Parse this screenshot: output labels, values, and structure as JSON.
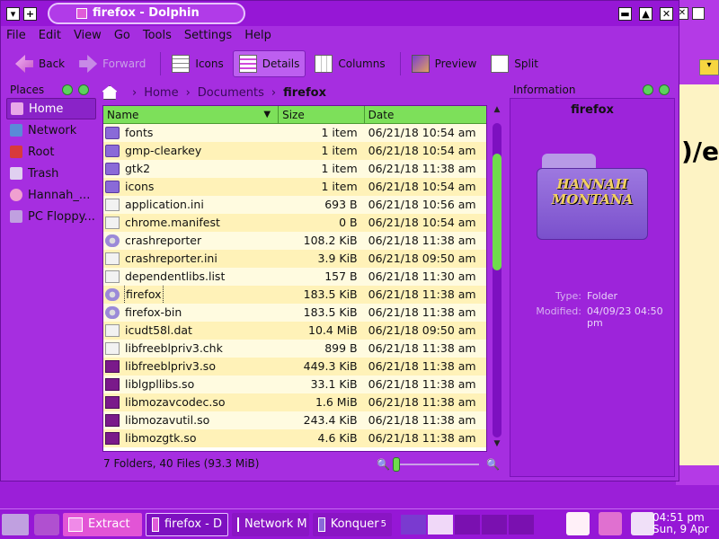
{
  "window": {
    "title": "firefox - Dolphin"
  },
  "menu": [
    "File",
    "Edit",
    "View",
    "Go",
    "Tools",
    "Settings",
    "Help"
  ],
  "toolbar": {
    "back": "Back",
    "forward": "Forward",
    "icons": "Icons",
    "details": "Details",
    "columns": "Columns",
    "preview": "Preview",
    "split": "Split"
  },
  "places": {
    "title": "Places",
    "items": [
      "Home",
      "Network",
      "Root",
      "Trash",
      "Hannah_...",
      "PC Floppy..."
    ]
  },
  "breadcrumb": {
    "items": [
      "Home",
      "Documents"
    ],
    "current": "firefox"
  },
  "table": {
    "headers": {
      "name": "Name",
      "size": "Size",
      "date": "Date"
    },
    "rows": [
      {
        "name": "fonts",
        "size": "1 item",
        "date": "06/21/18 10:54 am",
        "icon": "folder"
      },
      {
        "name": "gmp-clearkey",
        "size": "1 item",
        "date": "06/21/18 10:54 am",
        "icon": "folder"
      },
      {
        "name": "gtk2",
        "size": "1 item",
        "date": "06/21/18 11:38 am",
        "icon": "folder"
      },
      {
        "name": "icons",
        "size": "1 item",
        "date": "06/21/18 10:54 am",
        "icon": "folder"
      },
      {
        "name": "application.ini",
        "size": "693 B",
        "date": "06/21/18 10:56 am",
        "icon": "file"
      },
      {
        "name": "chrome.manifest",
        "size": "0 B",
        "date": "06/21/18 10:54 am",
        "icon": "file"
      },
      {
        "name": "crashreporter",
        "size": "108.2 KiB",
        "date": "06/21/18 11:38 am",
        "icon": "gear"
      },
      {
        "name": "crashreporter.ini",
        "size": "3.9 KiB",
        "date": "06/21/18 09:50 am",
        "icon": "file"
      },
      {
        "name": "dependentlibs.list",
        "size": "157 B",
        "date": "06/21/18 11:30 am",
        "icon": "file"
      },
      {
        "name": "firefox",
        "size": "183.5 KiB",
        "date": "06/21/18 11:38 am",
        "icon": "gear"
      },
      {
        "name": "firefox-bin",
        "size": "183.5 KiB",
        "date": "06/21/18 11:38 am",
        "icon": "gear"
      },
      {
        "name": "icudt58l.dat",
        "size": "10.4 MiB",
        "date": "06/21/18 09:50 am",
        "icon": "file"
      },
      {
        "name": "libfreeblpriv3.chk",
        "size": "899 B",
        "date": "06/21/18 11:38 am",
        "icon": "file"
      },
      {
        "name": "libfreeblpriv3.so",
        "size": "449.3 KiB",
        "date": "06/21/18 11:38 am",
        "icon": "lib"
      },
      {
        "name": "liblgpllibs.so",
        "size": "33.1 KiB",
        "date": "06/21/18 11:38 am",
        "icon": "lib"
      },
      {
        "name": "libmozavcodec.so",
        "size": "1.6 MiB",
        "date": "06/21/18 11:38 am",
        "icon": "lib"
      },
      {
        "name": "libmozavutil.so",
        "size": "243.4 KiB",
        "date": "06/21/18 11:38 am",
        "icon": "lib"
      },
      {
        "name": "libmozgtk.so",
        "size": "4.6 KiB",
        "date": "06/21/18 11:38 am",
        "icon": "lib"
      }
    ]
  },
  "info": {
    "title": "Information",
    "name": "firefox",
    "logo_line1": "HANNAH",
    "logo_line2": "MONTANA",
    "type_label": "Type:",
    "type_value": "Folder",
    "modified_label": "Modified:",
    "modified_value": "04/09/23 04:50 pm"
  },
  "status": {
    "text": "7 Folders, 40 Files (93.3 MiB)"
  },
  "taskbar": {
    "items": [
      "Extract",
      "firefox - D",
      "Network M",
      "Konquer"
    ],
    "konqueror_count": "5",
    "time": "04:51 pm",
    "date": "Sun, 9 Apr"
  },
  "colors": {
    "accent": "#9b1fd8",
    "highlight": "#7de05a",
    "row_alt": "#fff2b8"
  }
}
